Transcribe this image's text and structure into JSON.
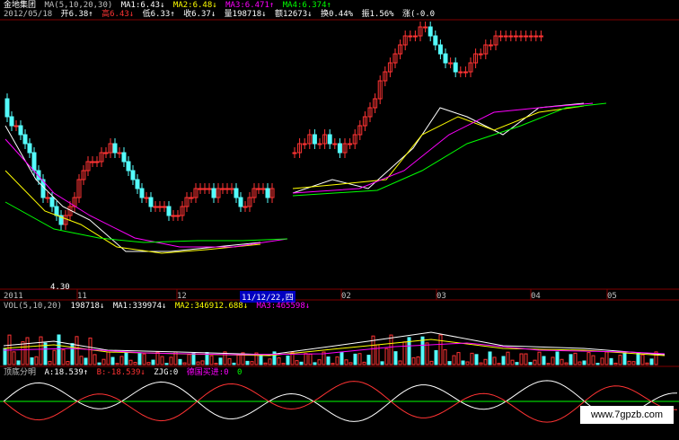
{
  "price_panel": {
    "stock_name": "金地集团",
    "ma_label": "MA(5,10,20,30)",
    "ma1": "MA1:6.43↓",
    "ma2": "MA2:6.48↓",
    "ma3": "MA3:6.471↑",
    "ma4": "MA4:6.374↑",
    "date": "2012/05/18",
    "open": "开6.38↑",
    "high": "高6.43↓",
    "low": "低6.33↑",
    "close": "收6.37↓",
    "volume": "量198718↓",
    "amount": "额12673↓",
    "turnover": "换0.44%",
    "amplitude": "振1.56%",
    "change": "涨(-0.0"
  },
  "x_axis": {
    "year_label": "2011",
    "month_labels": [
      "11",
      "12",
      "02",
      "03",
      "04",
      "05"
    ],
    "cursor_label": "11/12/22,四"
  },
  "low_marker": "4.30",
  "volume_panel": {
    "label": "VOL(5,10,20)",
    "value": "198718↓",
    "ma1": "MA1:339974↓",
    "ma2": "MA2:346912.688↓",
    "ma3": "MA3:465598↓"
  },
  "indicator_panel": {
    "label": "顶底分明",
    "a": "A:18.539↑",
    "b": "B:-18.539↓",
    "zjg": "ZJG:0",
    "extra": "德国买进:0",
    "extra2": "0"
  },
  "watermark": "www.7gpzb.com",
  "colors": {
    "up": "#ff3333",
    "down": "#54fcfc",
    "ma5": "#ffffff",
    "ma10": "#ffff00",
    "ma20": "#ff00ff",
    "ma30": "#00ff00",
    "grid": "#800000"
  },
  "chart_data": {
    "type": "candlestick",
    "price_ylim": [
      4.0,
      7.0
    ],
    "vol_ylim": [
      0,
      1400000
    ],
    "ind_ylim": [
      -60,
      60
    ],
    "candles_o": [
      6.1,
      5.9,
      5.8,
      5.8,
      5.7,
      5.6,
      5.5,
      5.3,
      5.2,
      5.0,
      5.0,
      4.9,
      4.8,
      4.7,
      4.8,
      4.9,
      5.0,
      5.2,
      5.3,
      5.4,
      5.4,
      5.4,
      5.5,
      5.5,
      5.6,
      5.5,
      5.5,
      5.4,
      5.3,
      5.2,
      5.1,
      5.0,
      5.0,
      4.9,
      4.9,
      4.9,
      4.9,
      4.8,
      4.8,
      4.8,
      4.9,
      5.0,
      5.0,
      5.1,
      5.1,
      5.1,
      5.1,
      5.0,
      5.1,
      5.1,
      5.1,
      5.1,
      5.0,
      4.9,
      4.9,
      5.0,
      5.1,
      5.1,
      5.1,
      5.0
    ],
    "candles_c": [
      5.9,
      5.8,
      5.8,
      5.7,
      5.6,
      5.5,
      5.3,
      5.2,
      5.0,
      5.0,
      4.9,
      4.8,
      4.7,
      4.8,
      4.9,
      5.0,
      5.2,
      5.3,
      5.4,
      5.4,
      5.4,
      5.5,
      5.5,
      5.6,
      5.5,
      5.5,
      5.4,
      5.3,
      5.2,
      5.1,
      5.0,
      5.0,
      4.9,
      4.9,
      4.9,
      4.9,
      4.8,
      4.8,
      4.8,
      4.9,
      5.0,
      5.0,
      5.1,
      5.1,
      5.1,
      5.1,
      5.0,
      5.1,
      5.1,
      5.1,
      5.1,
      5.0,
      4.9,
      4.9,
      5.0,
      5.1,
      5.1,
      5.1,
      5.0,
      5.1
    ],
    "candles2_o": [
      5.5,
      5.5,
      5.6,
      5.6,
      5.7,
      5.6,
      5.6,
      5.7,
      5.6,
      5.6,
      5.5,
      5.6,
      5.6,
      5.7,
      5.8,
      5.9,
      6.0,
      6.1,
      6.3,
      6.4,
      6.5,
      6.6,
      6.7,
      6.8,
      6.8,
      6.8,
      6.9,
      6.9,
      6.8,
      6.7,
      6.6,
      6.5,
      6.5,
      6.4,
      6.4,
      6.4,
      6.5,
      6.6,
      6.6,
      6.7,
      6.7,
      6.8,
      6.8,
      6.8,
      6.8,
      6.8,
      6.8,
      6.8,
      6.8,
      6.8
    ],
    "candles2_c": [
      5.5,
      5.6,
      5.6,
      5.7,
      5.6,
      5.6,
      5.7,
      5.6,
      5.6,
      5.5,
      5.6,
      5.6,
      5.7,
      5.8,
      5.9,
      6.0,
      6.1,
      6.3,
      6.4,
      6.5,
      6.6,
      6.7,
      6.8,
      6.8,
      6.8,
      6.9,
      6.9,
      6.8,
      6.7,
      6.6,
      6.5,
      6.5,
      6.4,
      6.4,
      6.4,
      6.5,
      6.6,
      6.6,
      6.7,
      6.7,
      6.8,
      6.8,
      6.8,
      6.8,
      6.8,
      6.8,
      6.8,
      6.8,
      6.8,
      6.8
    ]
  }
}
